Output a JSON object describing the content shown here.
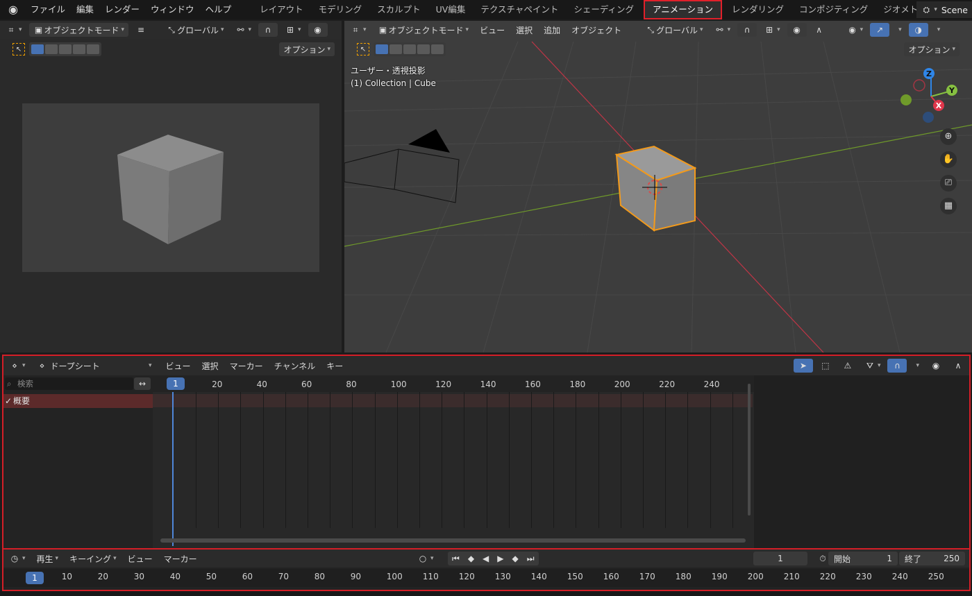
{
  "topbar": {
    "menus": [
      "ファイル",
      "編集",
      "レンダー",
      "ウィンドウ",
      "ヘルプ"
    ],
    "workspace_tabs": [
      "レイアウト",
      "モデリング",
      "スカルプト",
      "UV編集",
      "テクスチャペイント",
      "シェーディング",
      "アニメーション",
      "レンダリング",
      "コンポジティング",
      "ジオメトリノ"
    ],
    "active_tab": "アニメーション",
    "scene": "Scene"
  },
  "left_viewport": {
    "mode": "オブジェクトモード",
    "transform": "グローバル",
    "options": "オプション"
  },
  "right_viewport": {
    "mode": "オブジェクトモード",
    "menus": [
      "ビュー",
      "選択",
      "追加",
      "オブジェクト"
    ],
    "transform": "グローバル",
    "options": "オプション",
    "view_label": "ユーザー・透視投影",
    "collection_label": "(1) Collection | Cube",
    "gizmo": {
      "x": "X",
      "y": "Y",
      "z": "Z"
    }
  },
  "dopesheet": {
    "editor": "ドープシート",
    "menus": [
      "ビュー",
      "選択",
      "マーカー",
      "チャンネル",
      "キー"
    ],
    "search_placeholder": "検索",
    "summary": "概要",
    "ruler_ticks": [
      "20",
      "40",
      "60",
      "80",
      "100",
      "120",
      "140",
      "160",
      "180",
      "200",
      "220",
      "240"
    ],
    "current_frame_label": "1"
  },
  "timeline": {
    "menus": [
      "再生",
      "キーイング",
      "ビュー",
      "マーカー"
    ],
    "current_frame": "1",
    "start_label": "開始",
    "start": "1",
    "end_label": "終了",
    "end": "250",
    "ruler_ticks": [
      "10",
      "20",
      "30",
      "40",
      "50",
      "60",
      "70",
      "80",
      "90",
      "100",
      "110",
      "120",
      "130",
      "140",
      "150",
      "160",
      "170",
      "180",
      "190",
      "200",
      "210",
      "220",
      "230",
      "240",
      "250"
    ],
    "current_frame_label": "1"
  },
  "colors": {
    "accent": "#4772b3",
    "highlight_outline": "#d51e27",
    "selection": "#f0a000",
    "x_axis": "#e0364b",
    "y_axis": "#86c041",
    "z_axis": "#2f86e8"
  }
}
